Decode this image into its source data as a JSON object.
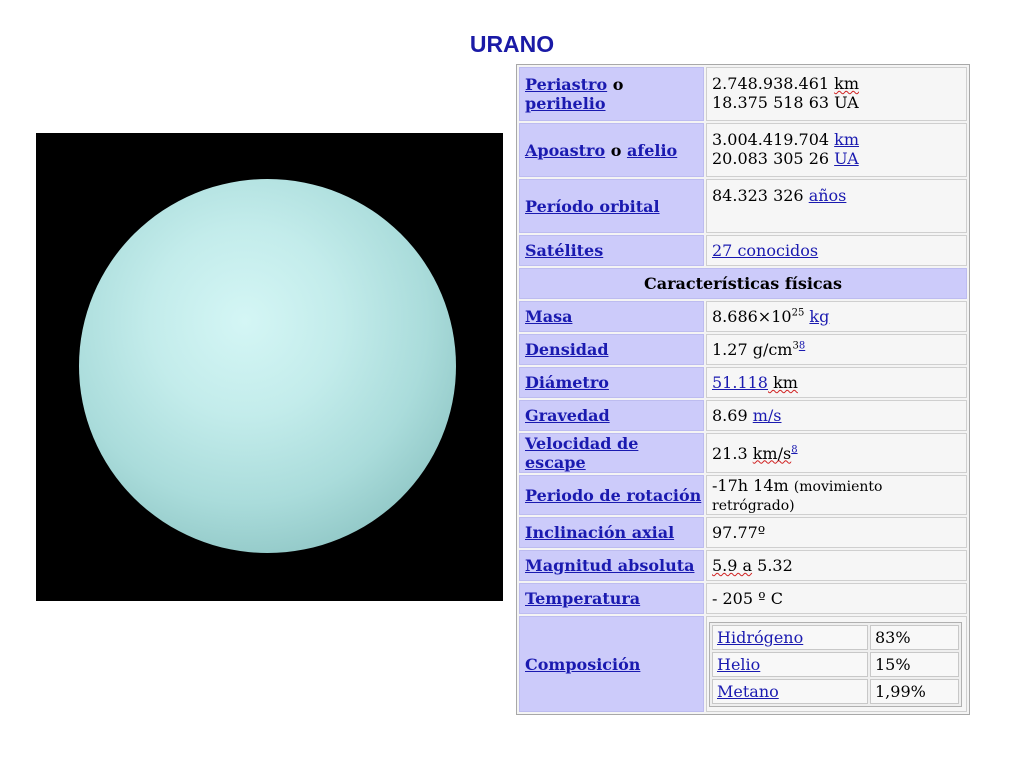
{
  "title": "URANO",
  "rows": {
    "periastro": {
      "label_a": "Periastro",
      "label_b": " o ",
      "label_c": "perihelio",
      "line1_num": "2.748.938.461 ",
      "line1_unit": "km",
      "line2": "18.375 518 63 UA"
    },
    "apoastro": {
      "label_a": "Apoastro",
      "label_b": " o ",
      "label_c": "afelio",
      "line1_num": "3.004.419.704 ",
      "line1_unit": "km",
      "line2_num": "20.083 305 26 ",
      "line2_unit": "UA"
    },
    "periodo_orbital": {
      "label": "Período orbital",
      "value_num": "84.323 326 ",
      "value_unit": "años"
    },
    "satelites": {
      "label": "Satélites",
      "value": "27 conocidos"
    },
    "section": "Características físicas",
    "masa": {
      "label": "Masa",
      "value_base": "8.686×10",
      "value_exp": "25",
      "value_unit": "kg"
    },
    "densidad": {
      "label": "Densidad",
      "value_base": "1.27 g/cm",
      "value_exp": "3",
      "value_ref": "8"
    },
    "diametro": {
      "label": "Diámetro",
      "value_num": "51.118",
      "value_unit": " km"
    },
    "gravedad": {
      "label": "Gravedad",
      "value_num": "8.69 ",
      "value_unit": "m/s"
    },
    "velocidad_escape": {
      "label": "Velocidad de escape",
      "value_num": "21.3 ",
      "value_unit": "km/s",
      "value_ref": "8"
    },
    "periodo_rotacion": {
      "label": "Periodo de rotación",
      "value_main": "-17h 14m ",
      "value_note": "(movimiento retrógrado)"
    },
    "inclinacion": {
      "label": "Inclinación axial",
      "value": "97.77º"
    },
    "magnitud": {
      "label": "Magnitud absoluta",
      "value_a": "5.9 a",
      "value_b": " 5.32"
    },
    "temperatura": {
      "label": "Temperatura",
      "value": "- 205 º C"
    },
    "composicion": {
      "label": "Composición",
      "items": [
        {
          "name": "Hidrógeno",
          "value": "83%"
        },
        {
          "name": "Helio",
          "value": "15%"
        },
        {
          "name": "Metano",
          "value": "1,99%"
        }
      ]
    }
  }
}
